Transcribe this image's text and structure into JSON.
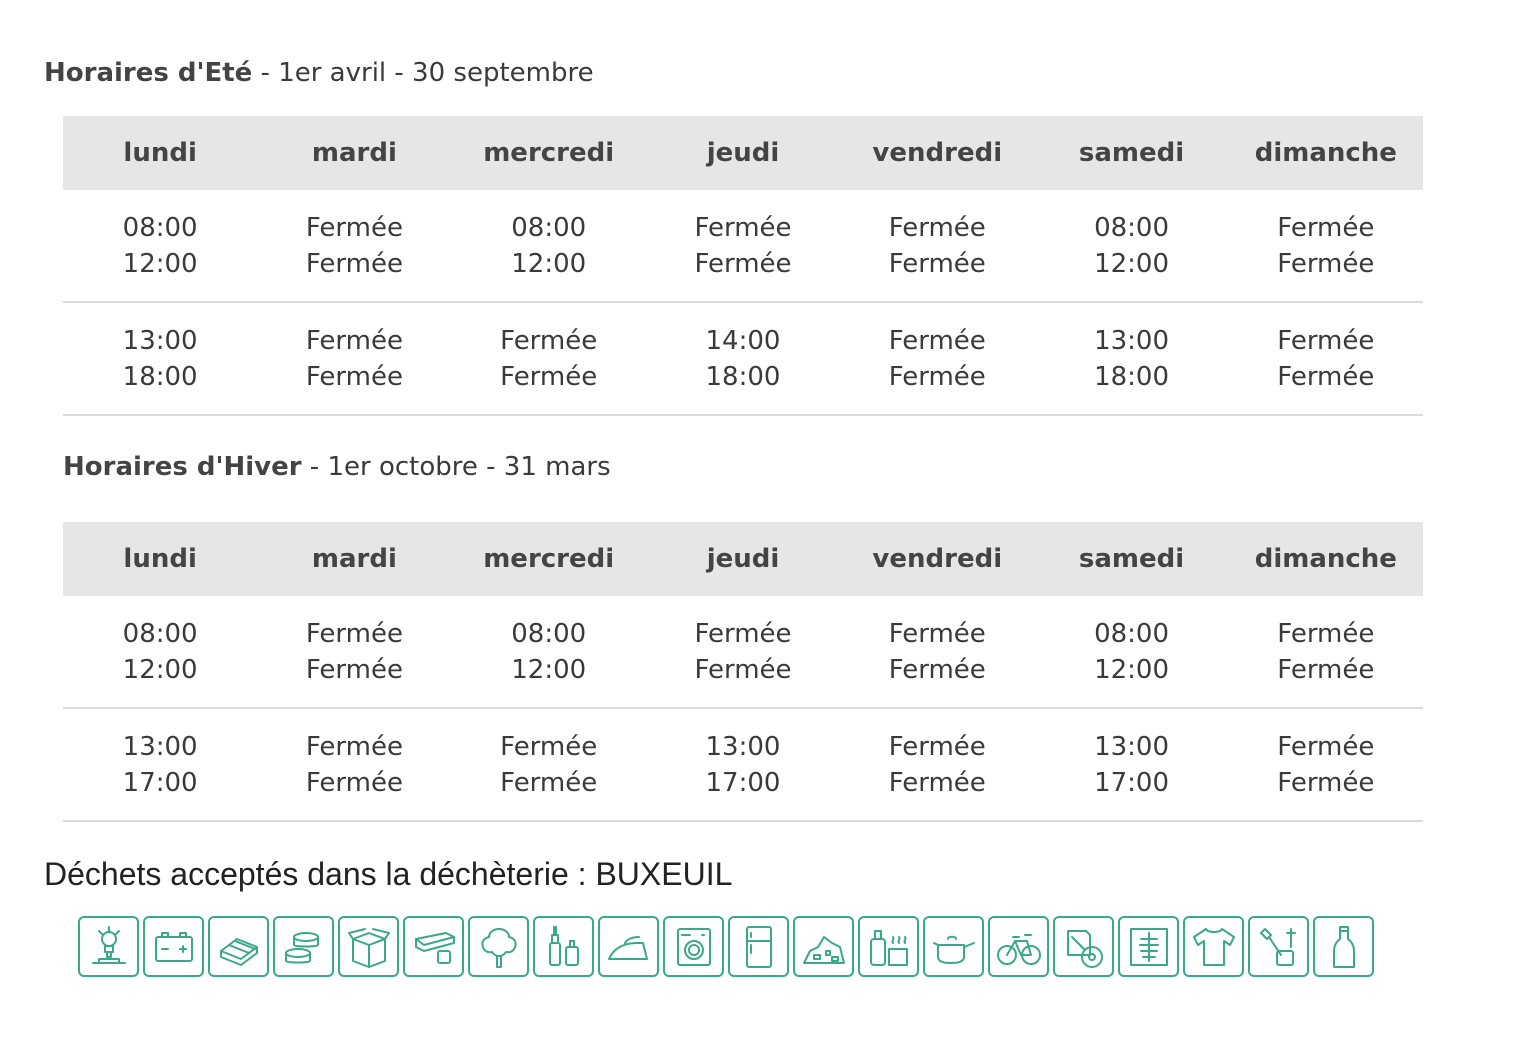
{
  "summer": {
    "title_bold": "Horaires d'Eté",
    "title_rest": " - 1er avril - 30 septembre",
    "days": [
      "lundi",
      "mardi",
      "mercredi",
      "jeudi",
      "vendredi",
      "samedi",
      "dimanche"
    ],
    "rows": [
      [
        [
          "08:00",
          "12:00"
        ],
        [
          "Fermée",
          "Fermée"
        ],
        [
          "08:00",
          "12:00"
        ],
        [
          "Fermée",
          "Fermée"
        ],
        [
          "Fermée",
          "Fermée"
        ],
        [
          "08:00",
          "12:00"
        ],
        [
          "Fermée",
          "Fermée"
        ]
      ],
      [
        [
          "13:00",
          "18:00"
        ],
        [
          "Fermée",
          "Fermée"
        ],
        [
          "Fermée",
          "Fermée"
        ],
        [
          "14:00",
          "18:00"
        ],
        [
          "Fermée",
          "Fermée"
        ],
        [
          "13:00",
          "18:00"
        ],
        [
          "Fermée",
          "Fermée"
        ]
      ]
    ]
  },
  "winter": {
    "title_bold": "Horaires d'Hiver",
    "title_rest": " - 1er octobre - 31 mars",
    "days": [
      "lundi",
      "mardi",
      "mercredi",
      "jeudi",
      "vendredi",
      "samedi",
      "dimanche"
    ],
    "rows": [
      [
        [
          "08:00",
          "12:00"
        ],
        [
          "Fermée",
          "Fermée"
        ],
        [
          "08:00",
          "12:00"
        ],
        [
          "Fermée",
          "Fermée"
        ],
        [
          "Fermée",
          "Fermée"
        ],
        [
          "08:00",
          "12:00"
        ],
        [
          "Fermée",
          "Fermée"
        ]
      ],
      [
        [
          "13:00",
          "17:00"
        ],
        [
          "Fermée",
          "Fermée"
        ],
        [
          "Fermée",
          "Fermée"
        ],
        [
          "13:00",
          "17:00"
        ],
        [
          "Fermée",
          "Fermée"
        ],
        [
          "13:00",
          "17:00"
        ],
        [
          "Fermée",
          "Fermée"
        ]
      ]
    ]
  },
  "waste": {
    "title": "Déchets acceptés dans la déchèterie : BUXEUIL",
    "icon_color": "#3aa88a",
    "icons": [
      "lamp-icon",
      "battery-icon",
      "pallet-icon",
      "metal-cans-icon",
      "cardboard-icon",
      "rolls-icon",
      "tree-icon",
      "paint-icon",
      "iron-icon",
      "washing-machine-icon",
      "fridge-icon",
      "rubble-icon",
      "chemical-bottles-icon",
      "pan-icon",
      "bicycle-icon",
      "cartridge-cd-icon",
      "xray-icon",
      "clothes-icon",
      "tools-icon",
      "glass-bottle-icon"
    ]
  }
}
